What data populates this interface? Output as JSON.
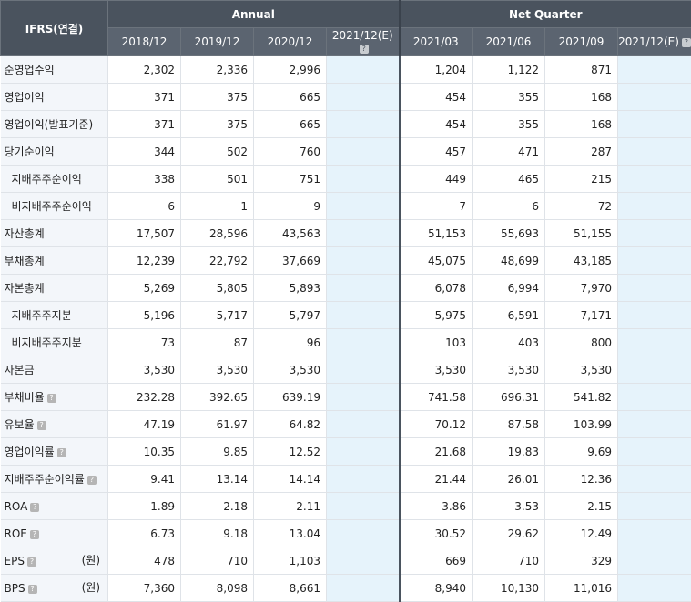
{
  "header": {
    "corner": "IFRS(연결)",
    "annual": "Annual",
    "quarter": "Net Quarter",
    "annual_periods": [
      "2018/12",
      "2019/12",
      "2020/12",
      "2021/12(E)"
    ],
    "quarter_periods": [
      "2021/03",
      "2021/06",
      "2021/09",
      "2021/12(E)"
    ]
  },
  "rows": [
    {
      "label": "순영업수익",
      "a": [
        "2,302",
        "2,336",
        "2,996",
        ""
      ],
      "q": [
        "1,204",
        "1,122",
        "871",
        ""
      ]
    },
    {
      "label": "영업이익",
      "a": [
        "371",
        "375",
        "665",
        ""
      ],
      "q": [
        "454",
        "355",
        "168",
        ""
      ]
    },
    {
      "label": "영업이익(발표기준)",
      "a": [
        "371",
        "375",
        "665",
        ""
      ],
      "q": [
        "454",
        "355",
        "168",
        ""
      ]
    },
    {
      "label": "당기순이익",
      "a": [
        "344",
        "502",
        "760",
        ""
      ],
      "q": [
        "457",
        "471",
        "287",
        ""
      ]
    },
    {
      "label": "지배주주순이익",
      "a": [
        "338",
        "501",
        "751",
        ""
      ],
      "q": [
        "449",
        "465",
        "215",
        ""
      ]
    },
    {
      "label": "비지배주주순이익",
      "a": [
        "6",
        "1",
        "9",
        ""
      ],
      "q": [
        "7",
        "6",
        "72",
        ""
      ]
    },
    {
      "label": "자산총계",
      "a": [
        "17,507",
        "28,596",
        "43,563",
        ""
      ],
      "q": [
        "51,153",
        "55,693",
        "51,155",
        ""
      ]
    },
    {
      "label": "부채총계",
      "a": [
        "12,239",
        "22,792",
        "37,669",
        ""
      ],
      "q": [
        "45,075",
        "48,699",
        "43,185",
        ""
      ]
    },
    {
      "label": "자본총계",
      "a": [
        "5,269",
        "5,805",
        "5,893",
        ""
      ],
      "q": [
        "6,078",
        "6,994",
        "7,970",
        ""
      ]
    },
    {
      "label": "지배주주지분",
      "a": [
        "5,196",
        "5,717",
        "5,797",
        ""
      ],
      "q": [
        "5,975",
        "6,591",
        "7,171",
        ""
      ]
    },
    {
      "label": "비지배주주지분",
      "a": [
        "73",
        "87",
        "96",
        ""
      ],
      "q": [
        "103",
        "403",
        "800",
        ""
      ]
    },
    {
      "label": "자본금",
      "a": [
        "3,530",
        "3,530",
        "3,530",
        ""
      ],
      "q": [
        "3,530",
        "3,530",
        "3,530",
        ""
      ]
    },
    {
      "label": "부채비율",
      "a": [
        "232.28",
        "392.65",
        "639.19",
        ""
      ],
      "q": [
        "741.58",
        "696.31",
        "541.82",
        ""
      ]
    },
    {
      "label": "유보율",
      "a": [
        "47.19",
        "61.97",
        "64.82",
        ""
      ],
      "q": [
        "70.12",
        "87.58",
        "103.99",
        ""
      ]
    },
    {
      "label": "영업이익률",
      "a": [
        "10.35",
        "9.85",
        "12.52",
        ""
      ],
      "q": [
        "21.68",
        "19.83",
        "9.69",
        ""
      ]
    },
    {
      "label": "지배주주순이익률",
      "a": [
        "9.41",
        "13.14",
        "14.14",
        ""
      ],
      "q": [
        "21.44",
        "26.01",
        "12.36",
        ""
      ]
    },
    {
      "label": "ROA",
      "a": [
        "1.89",
        "2.18",
        "2.11",
        ""
      ],
      "q": [
        "3.86",
        "3.53",
        "2.15",
        ""
      ]
    },
    {
      "label": "ROE",
      "a": [
        "6.73",
        "9.18",
        "13.04",
        ""
      ],
      "q": [
        "30.52",
        "29.62",
        "12.49",
        ""
      ]
    },
    {
      "label": "EPS",
      "unit": "(원)",
      "a": [
        "478",
        "710",
        "1,103",
        ""
      ],
      "q": [
        "669",
        "710",
        "329",
        ""
      ]
    },
    {
      "label": "BPS",
      "unit": "(원)",
      "a": [
        "7,360",
        "8,098",
        "8,661",
        ""
      ],
      "q": [
        "8,940",
        "10,130",
        "11,016",
        ""
      ]
    }
  ],
  "help_rows": [
    12,
    13,
    14,
    15,
    16,
    17,
    18,
    19
  ],
  "sub_rows": [
    4,
    5,
    9,
    10
  ],
  "help_icon": "question-mark-icon"
}
